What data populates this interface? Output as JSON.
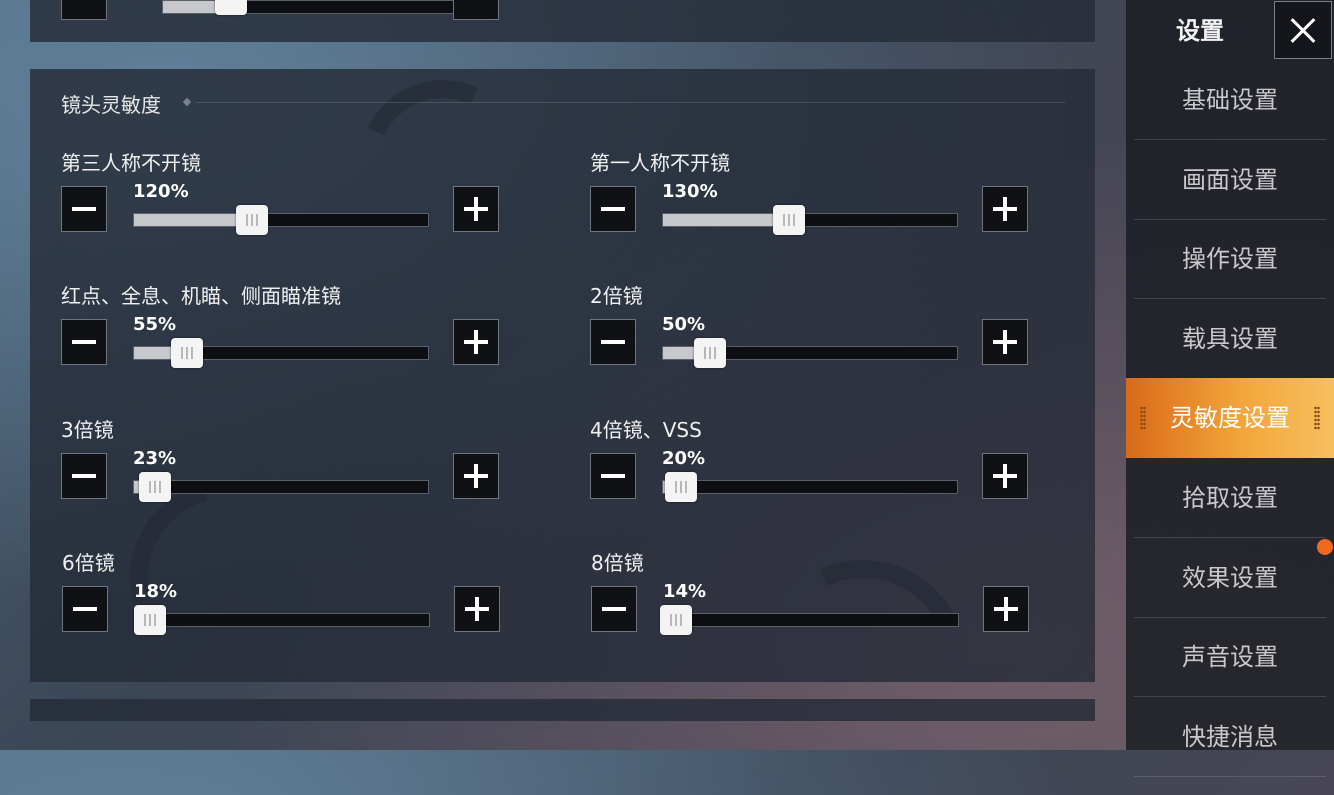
{
  "sidebar": {
    "title": "设置",
    "close_icon": "close-icon",
    "items": [
      {
        "label": "基础设置",
        "active": false
      },
      {
        "label": "画面设置",
        "active": false
      },
      {
        "label": "操作设置",
        "active": false
      },
      {
        "label": "载具设置",
        "active": false
      },
      {
        "label": "灵敏度设置",
        "active": true
      },
      {
        "label": "拾取设置",
        "active": false
      },
      {
        "label": "效果设置",
        "active": false,
        "notification": true
      },
      {
        "label": "声音设置",
        "active": false
      },
      {
        "label": "快捷消息",
        "active": false
      }
    ],
    "accent_color": "#f29a30",
    "notification_color": "#f06a1e"
  },
  "section": {
    "title": "镜头灵敏度",
    "settings": [
      {
        "label": "第三人称不开镜",
        "value_text": "120%",
        "level": 0.4
      },
      {
        "label": "第一人称不开镜",
        "value_text": "130%",
        "level": 0.43
      },
      {
        "label": "红点、全息、机瞄、侧面瞄准镜",
        "value_text": "55%",
        "level": 0.18
      },
      {
        "label": "2倍镜",
        "value_text": "50%",
        "level": 0.16
      },
      {
        "label": "3倍镜",
        "value_text": "23%",
        "level": 0.07
      },
      {
        "label": "4倍镜、VSS",
        "value_text": "20%",
        "level": 0.06
      },
      {
        "label": "6倍镜",
        "value_text": "18%",
        "level": 0.05
      },
      {
        "label": "8倍镜",
        "value_text": "14%",
        "level": 0.04
      }
    ]
  },
  "top_partial_slider": {
    "level": 0.23
  }
}
